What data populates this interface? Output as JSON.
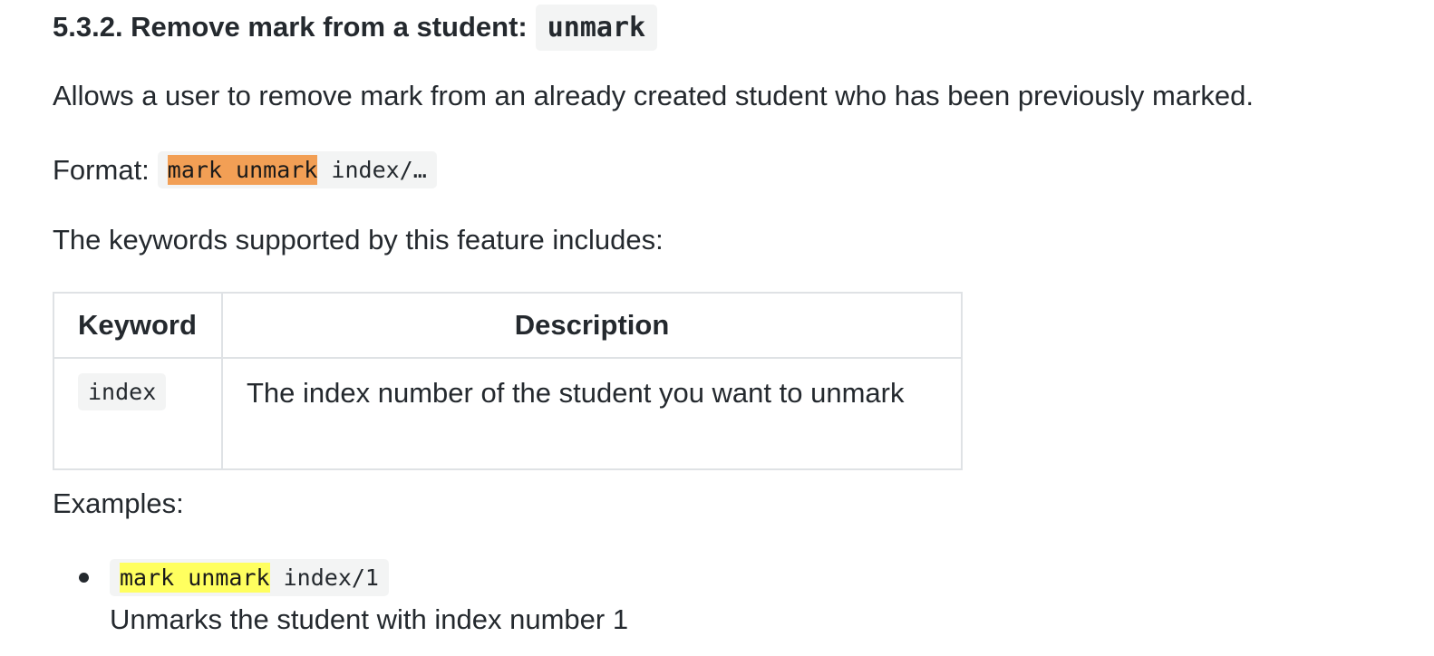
{
  "heading": {
    "prefix": "5.3.2. Remove mark from a student:",
    "command": "unmark"
  },
  "description": "Allows a user to remove mark from an already created student who has been previously marked.",
  "format": {
    "label": "Format:",
    "command_highlight": "mark unmark",
    "command_rest": " index/…",
    "highlight_color": "#f29f55"
  },
  "keywords_intro": "The keywords supported by this feature includes:",
  "table": {
    "headers": [
      "Keyword",
      "Description"
    ],
    "rows": [
      {
        "keyword": "index",
        "description": "The index number of the student you want to unmark"
      }
    ]
  },
  "examples": {
    "label": "Examples:",
    "items": [
      {
        "command_highlight": "mark unmark",
        "command_rest": " index/1",
        "description": "Unmarks the student with index number 1",
        "highlight_color": "#ffff5f"
      }
    ]
  }
}
